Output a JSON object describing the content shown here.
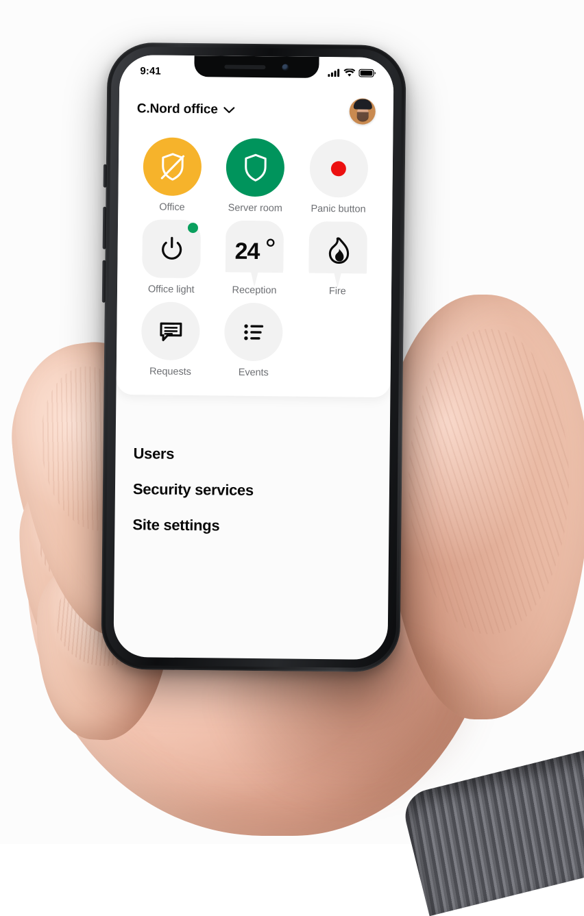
{
  "scene": {
    "description": "hand-holding-phone-photo",
    "background_color": "#ffffff"
  },
  "device": {
    "frame_color": "#17181a",
    "side_buttons": [
      "mute-switch",
      "volume-up",
      "volume-down"
    ]
  },
  "status_bar": {
    "time": "9:41",
    "icons": [
      "cellular-signal-icon",
      "wifi-icon",
      "battery-icon"
    ],
    "signal_bars": 4,
    "battery_level_pct": 92
  },
  "app_header": {
    "site_name": "C.Nord office",
    "chevron_icon": "chevron-down-icon",
    "avatar_alt": "user-avatar"
  },
  "colors": {
    "yellow": "#F6B32B",
    "green": "#00945C",
    "green_dot": "#0AA05E",
    "red": "#EC1111",
    "tile_gray": "#F2F2F2",
    "label_gray": "#6D6F73",
    "text_black": "#0A0A0A"
  },
  "tiles": [
    {
      "label": "Office",
      "icon": "shield-off-icon",
      "shape": "circle",
      "bg": "#F6B32B",
      "icon_color": "#FFFFFF",
      "badge": null,
      "state": "disarmed"
    },
    {
      "label": "Server room",
      "icon": "shield-icon",
      "shape": "circle",
      "bg": "#00945C",
      "icon_color": "#FFFFFF",
      "badge": null,
      "state": "armed"
    },
    {
      "label": "Panic button",
      "icon": "panic-dot-icon",
      "shape": "circle",
      "bg": "#F2F2F2",
      "icon_color": "#EC1111",
      "badge": null,
      "state": "idle"
    },
    {
      "label": "Office light",
      "icon": "power-icon",
      "shape": "squircle",
      "bg": "#F2F2F2",
      "icon_color": "#0B0B0B",
      "badge": "#0AA05E",
      "state": "on"
    },
    {
      "label": "Reception",
      "icon": "temperature-value",
      "shape": "badge",
      "bg": "#F2F2F2",
      "icon_color": "#0B0B0B",
      "badge": null,
      "value": "24",
      "unit": "°"
    },
    {
      "label": "Fire",
      "icon": "flame-icon",
      "shape": "badge",
      "bg": "#F2F2F2",
      "icon_color": "#0B0B0B",
      "badge": null,
      "state": "normal"
    },
    {
      "label": "Requests",
      "icon": "chat-bubble-icon",
      "shape": "circle",
      "bg": "#F2F2F2",
      "icon_color": "#0B0B0B",
      "badge": null
    },
    {
      "label": "Events",
      "icon": "list-bullet-icon",
      "shape": "circle",
      "bg": "#F2F2F2",
      "icon_color": "#0B0B0B",
      "badge": null
    }
  ],
  "menu": {
    "items": [
      {
        "label": "Users"
      },
      {
        "label": "Security services"
      },
      {
        "label": "Site settings"
      }
    ]
  }
}
